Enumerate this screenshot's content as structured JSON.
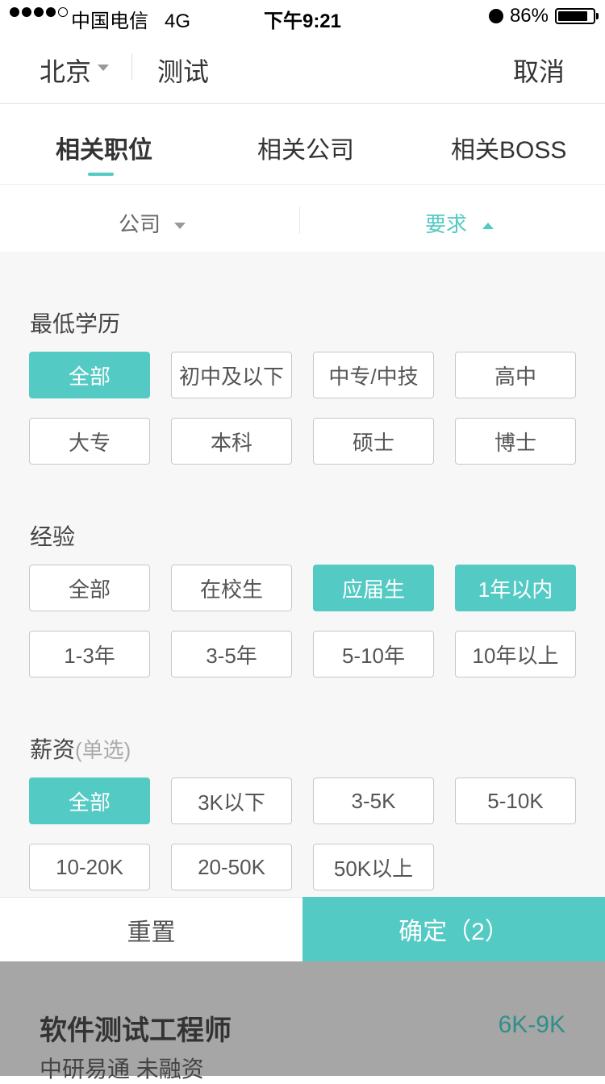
{
  "status_bar": {
    "carrier": "中国电信",
    "network": "4G",
    "time": "下午9:21",
    "battery": "86%"
  },
  "header": {
    "city": "北京",
    "query": "测试",
    "cancel": "取消"
  },
  "tabs": [
    {
      "label": "相关职位"
    },
    {
      "label": "相关公司"
    },
    {
      "label": "相关BOSS"
    }
  ],
  "filters": {
    "company": "公司",
    "requirements": "要求"
  },
  "sections": {
    "education": {
      "title": "最低学历",
      "options": [
        "全部",
        "初中及以下",
        "中专/中技",
        "高中",
        "大专",
        "本科",
        "硕士",
        "博士"
      ],
      "selected": [
        "全部"
      ]
    },
    "experience": {
      "title": "经验",
      "options": [
        "全部",
        "在校生",
        "应届生",
        "1年以内",
        "1-3年",
        "3-5年",
        "5-10年",
        "10年以上"
      ],
      "selected": [
        "应届生",
        "1年以内"
      ]
    },
    "salary": {
      "title": "薪资",
      "note": "(单选)",
      "options": [
        "全部",
        "3K以下",
        "3-5K",
        "5-10K",
        "10-20K",
        "20-50K",
        "50K以上"
      ],
      "selected": [
        "全部"
      ]
    }
  },
  "actions": {
    "reset": "重置",
    "confirm": "确定（2）"
  },
  "job": {
    "title": "软件测试工程师",
    "salary": "6K-9K",
    "company": "中研易通 未融资"
  },
  "colors": {
    "accent": "#53cac3",
    "salary_text": "#2f8f89"
  }
}
